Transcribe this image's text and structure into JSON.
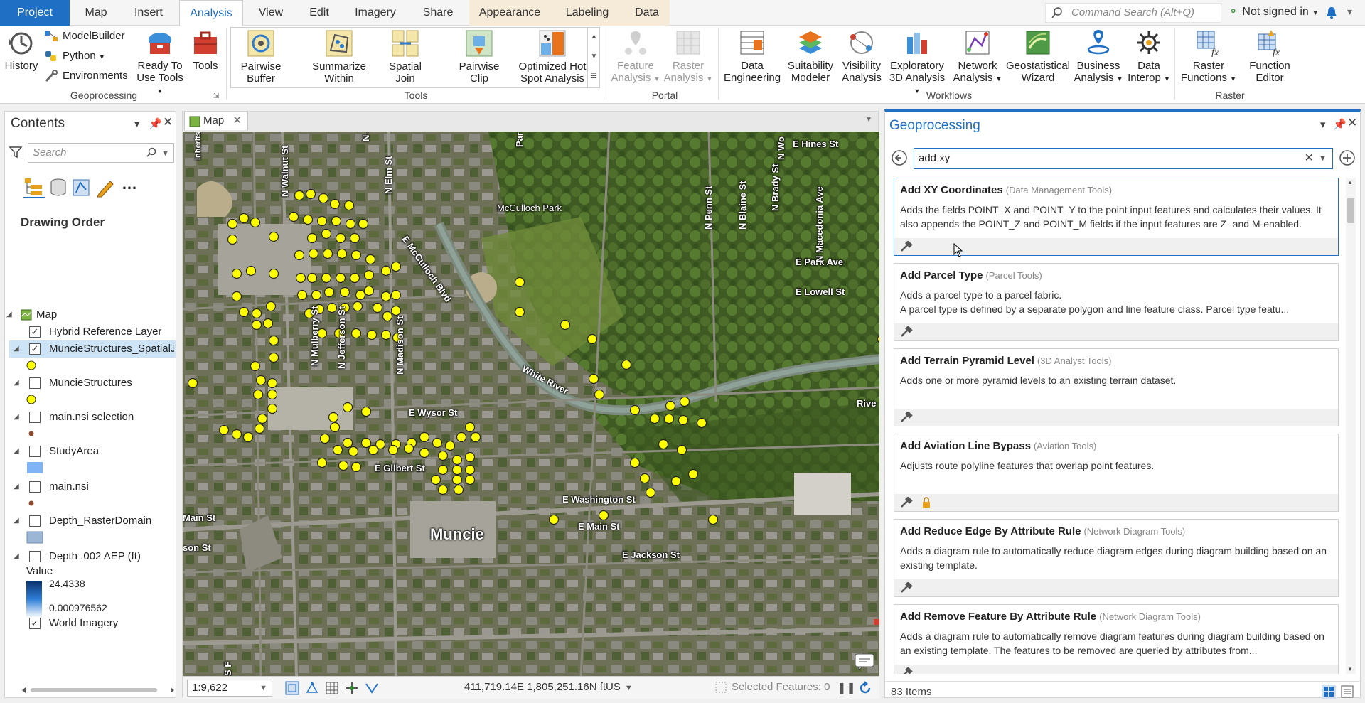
{
  "tabs": {
    "project": "Project",
    "map": "Map",
    "insert": "Insert",
    "analysis": "Analysis",
    "view": "View",
    "edit": "Edit",
    "imagery": "Imagery",
    "share": "Share",
    "appearance": "Appearance",
    "labeling": "Labeling",
    "data": "Data"
  },
  "command_search": {
    "placeholder": "Command Search (Alt+Q)"
  },
  "sign_in": "Not signed in",
  "ribbon": {
    "geoprocessing": {
      "history": "History",
      "modelbuilder": "ModelBuilder",
      "python": "Python",
      "environments": "Environments",
      "ready_to_use_1": "Ready To",
      "ready_to_use_2": "Use Tools",
      "tools": "Tools",
      "label": "Geoprocessing"
    },
    "tools": {
      "pairwise_buffer_1": "Pairwise",
      "pairwise_buffer_2": "Buffer",
      "summarize_within_1": "Summarize",
      "summarize_within_2": "Within",
      "spatial_join_1": "Spatial",
      "spatial_join_2": "Join",
      "pairwise_clip_1": "Pairwise",
      "pairwise_clip_2": "Clip",
      "hotspot_1": "Optimized Hot",
      "hotspot_2": "Spot Analysis",
      "label": "Tools"
    },
    "portal": {
      "feature_1": "Feature",
      "feature_2": "Analysis",
      "raster_1": "Raster",
      "raster_2": "Analysis",
      "label": "Portal"
    },
    "workflows": {
      "data_eng_1": "Data",
      "data_eng_2": "Engineering",
      "suit_1": "Suitability",
      "suit_2": "Modeler",
      "vis_1": "Visibility",
      "vis_2": "Analysis",
      "expl_1": "Exploratory",
      "expl_2": "3D Analysis",
      "net_1": "Network",
      "net_2": "Analysis",
      "geo_1": "Geostatistical",
      "geo_2": "Wizard",
      "bus_1": "Business",
      "bus_2": "Analysis",
      "interop_1": "Data",
      "interop_2": "Interop",
      "label": "Workflows"
    },
    "raster": {
      "rf_1": "Raster",
      "rf_2": "Functions",
      "fe_1": "Function",
      "fe_2": "Editor",
      "label": "Raster"
    }
  },
  "contents": {
    "title": "Contents",
    "search_placeholder": "Search",
    "drawing_order": "Drawing Order",
    "layers": [
      {
        "name": "Map",
        "checked": null
      },
      {
        "name": "Hybrid Reference Layer",
        "checked": true
      },
      {
        "name": "MuncieStructures_SpatialJoi",
        "checked": true
      },
      {
        "name": "MuncieStructures",
        "checked": false
      },
      {
        "name": "main.nsi selection",
        "checked": false
      },
      {
        "name": "StudyArea",
        "checked": false
      },
      {
        "name": "main.nsi",
        "checked": false
      },
      {
        "name": "Depth_RasterDomain",
        "checked": false
      },
      {
        "name": "Depth .002 AEP (ft)",
        "checked": false
      },
      {
        "name": "World Imagery",
        "checked": true
      }
    ],
    "legend": {
      "title": "Value",
      "high": "24.4338",
      "low": "0.000976562"
    }
  },
  "map": {
    "tab": "Map",
    "labels": {
      "walnut": "N Walnut St",
      "elm": "N Elm St",
      "mcculloch_park": "McCulloch Park",
      "mcculloch_blvd": "E McCulloch Blvd",
      "mulberry": "N Mulberry St",
      "jefferson": "N Jefferson St",
      "madison": "N Madison St",
      "white_river": "White River",
      "wysor": "E Wysor St",
      "gilbert": "E Gilbert St",
      "washington": "E Washington St",
      "main": "E Main St",
      "jackson": "E Jackson St",
      "muncie": "Muncie",
      "main_w": "Main St",
      "jackson_w": "son St",
      "hines": "E Hines St",
      "park_ave": "E Park Ave",
      "lowell": "E Lowell St",
      "penn": "N Penn St",
      "blaine": "N Blaine St",
      "brady": "N Brady St",
      "macedonia": "N Macedonia Ave",
      "rive": "Rive",
      "wo": "N Wo",
      "jeff": "N Jeff",
      "par": "Par",
      "sf": "S F",
      "inherits": "Inherits"
    },
    "scale": "1:9,622",
    "coords": "411,719.14E 1,805,251.16N ftUS",
    "selected_features": "Selected Features: 0"
  },
  "geoprocessing": {
    "title": "Geoprocessing",
    "search_value": "add xy",
    "results": [
      {
        "name": "Add XY Coordinates",
        "toolbox": "(Data Management Tools)",
        "desc": "Adds the fields POINT_X and POINT_Y to the point input features and calculates their values. It also appends the POINT_Z and POINT_M fields if the input features are Z- and M-enabled."
      },
      {
        "name": "Add Parcel Type",
        "toolbox": "(Parcel Tools)",
        "desc": "Adds a parcel type to a parcel fabric.\nA parcel type is defined by a separate polygon and  line feature class. Parcel type featu..."
      },
      {
        "name": "Add Terrain Pyramid Level",
        "toolbox": "(3D Analyst Tools)",
        "desc": "Adds one or more pyramid levels to an existing terrain dataset."
      },
      {
        "name": "Add Aviation Line Bypass",
        "toolbox": "(Aviation Tools)",
        "desc": "Adjusts route polyline features that overlap point features."
      },
      {
        "name": "Add Reduce Edge By Attribute Rule",
        "toolbox": "(Network Diagram Tools)",
        "desc": "Adds a diagram rule to automatically reduce diagram edges during diagram building  based on an existing template."
      },
      {
        "name": "Add Remove Feature By Attribute Rule",
        "toolbox": "(Network Diagram Tools)",
        "desc": "Adds a diagram rule to automatically remove diagram features during diagram building based on an existing template. The features to be removed are queried by attributes from..."
      }
    ],
    "count": "83 Items"
  }
}
